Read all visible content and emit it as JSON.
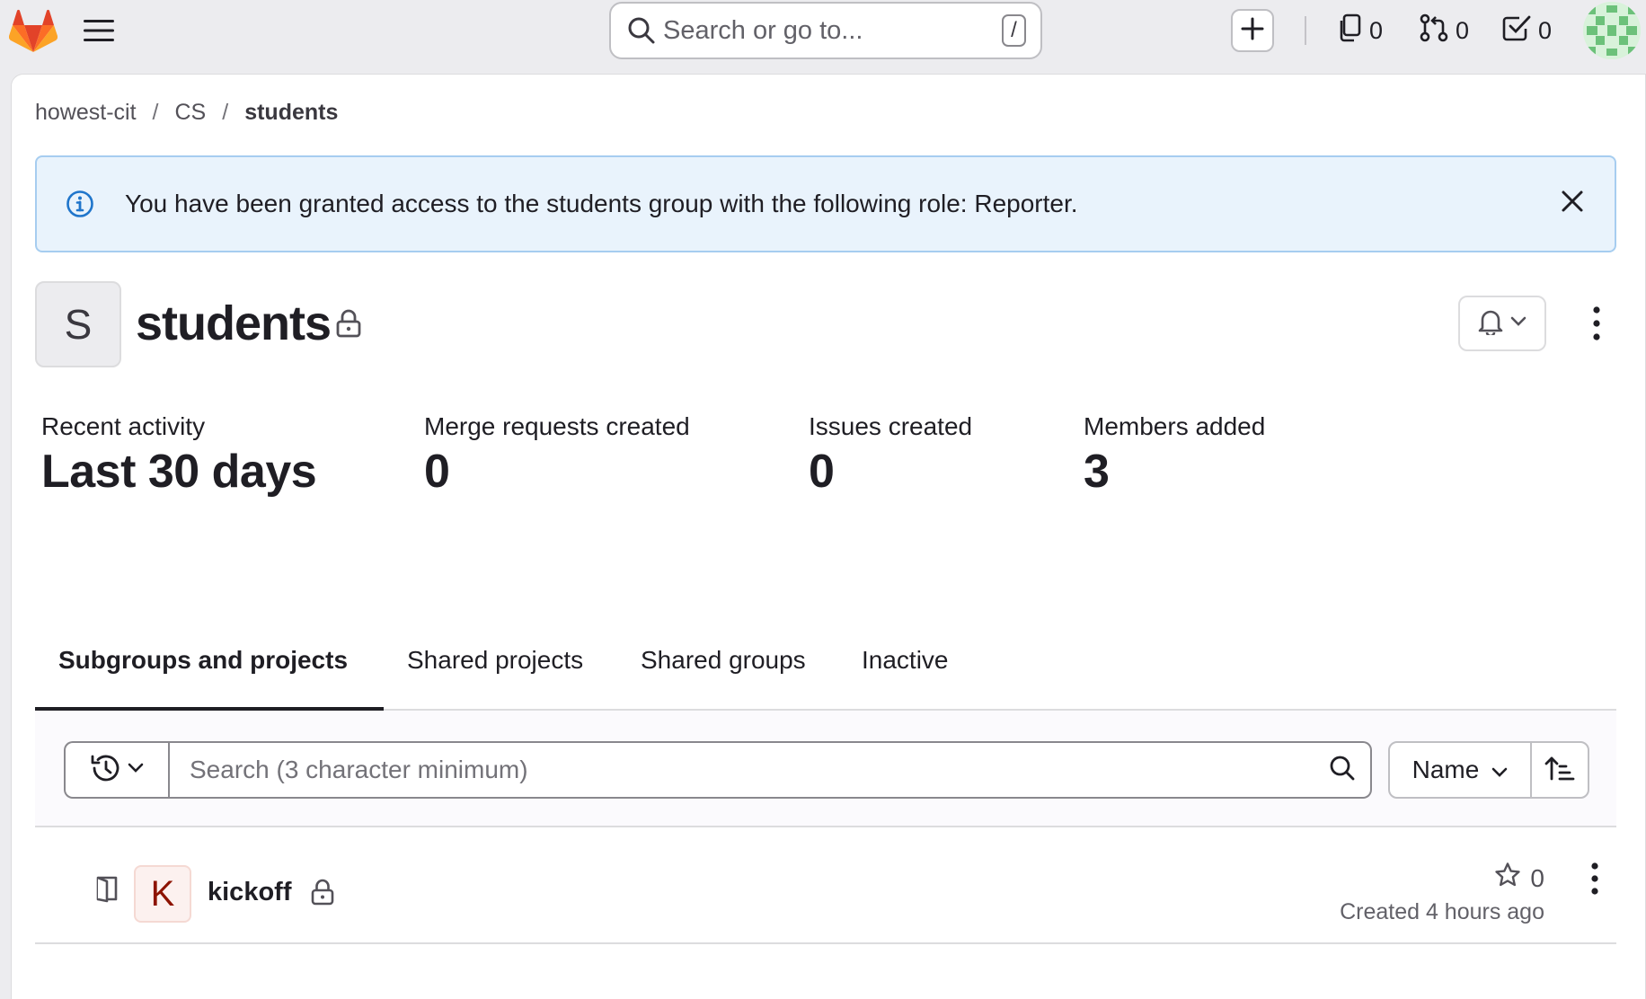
{
  "topbar": {
    "search_placeholder": "Search or go to...",
    "search_shortcut": "/",
    "issues_count": "0",
    "merge_requests_count": "0",
    "todos_count": "0"
  },
  "breadcrumb": {
    "items": [
      "howest-cit",
      "CS",
      "students"
    ],
    "separator": "/"
  },
  "alert": {
    "message": "You have been granted access to the students group with the following role: Reporter."
  },
  "group": {
    "avatar_letter": "S",
    "name": "students"
  },
  "stats": [
    {
      "label": "Recent activity",
      "value": "Last 30 days"
    },
    {
      "label": "Merge requests created",
      "value": "0"
    },
    {
      "label": "Issues created",
      "value": "0"
    },
    {
      "label": "Members added",
      "value": "3"
    }
  ],
  "tabs": [
    {
      "label": "Subgroups and projects",
      "active": true
    },
    {
      "label": "Shared projects",
      "active": false
    },
    {
      "label": "Shared groups",
      "active": false
    },
    {
      "label": "Inactive",
      "active": false
    }
  ],
  "filter": {
    "search_placeholder": "Search (3 character minimum)",
    "sort_label": "Name"
  },
  "projects": [
    {
      "avatar_letter": "K",
      "name": "kickoff",
      "stars": "0",
      "created": "Created 4 hours ago"
    }
  ],
  "colors": {
    "brand_orange": "#fc6d26",
    "alert_bg": "#e9f3fc",
    "alert_border": "#a6cdf0",
    "info_blue": "#1f75cb",
    "project_avatar_text": "#8d1300"
  }
}
